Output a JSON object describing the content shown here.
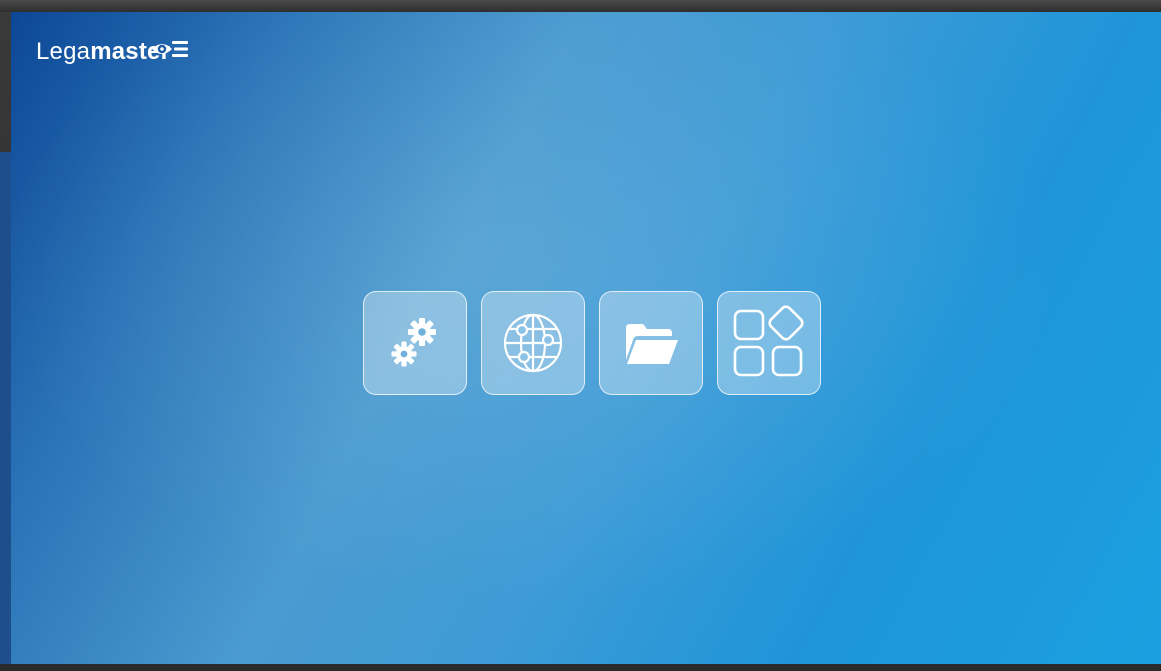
{
  "brand": {
    "name_light": "Lega",
    "name_bold": "master"
  },
  "dock": {
    "items": [
      {
        "name": "settings",
        "icon": "gears-icon"
      },
      {
        "name": "browser",
        "icon": "globe-network-icon"
      },
      {
        "name": "files",
        "icon": "folder-open-icon"
      },
      {
        "name": "apps",
        "icon": "apps-grid-icon"
      }
    ]
  },
  "colors": {
    "wallpaper_start": "#0c4796",
    "wallpaper_mid": "#4a9bd0",
    "wallpaper_end": "#1aa0e0",
    "icon": "#ffffff"
  }
}
